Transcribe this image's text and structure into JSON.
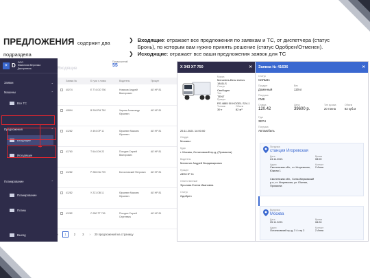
{
  "slide": {
    "title": "ПРЕДЛОЖЕНИЯ",
    "subtitle": "содержит два подраздела",
    "bullets": [
      {
        "lead": "Входящие",
        "text": ": отражает все предложения по заявкам и ТС, от диспетчера (статус Бронь), по которым вам нужно принять решение (статус Одобрен/Отменен)."
      },
      {
        "lead": "Исходящие",
        "text": ": отражает все ваши предложения заявок для ТС"
      }
    ]
  },
  "app": {
    "org_line1": "ООО",
    "org_line2": "Мамонова Вероника Дмитриевна",
    "sidebar": {
      "sections": [
        {
          "label": "Заявки"
        },
        {
          "label": "Машины"
        },
        {
          "label": "Предложения"
        },
        {
          "label": "Планирование"
        }
      ],
      "items": [
        {
          "label": "Все ТС"
        },
        {
          "label": "Входящие"
        },
        {
          "label": "Исходящие"
        },
        {
          "label": "Планирование"
        },
        {
          "label": "Планы"
        },
        {
          "label": "Выход"
        }
      ]
    },
    "main": {
      "ghost_title": "Входящие",
      "count_label": "Предложений",
      "count": "55",
      "columns": [
        "Заявка №",
        "Б гузи х ловок",
        "Водитель",
        "Прицеп"
      ],
      "rows": [
        {
          "id": "40274",
          "plate": "Е 774 ОО 750",
          "driver": "Новиков Андрей Викторович",
          "trailer": "АЕ НР 81"
        },
        {
          "id": "40894",
          "plate": "В 296 РМ 750",
          "driver": "Черняк Александр Юрьевич",
          "trailer": "АЕ НР 81"
        },
        {
          "id": "41282",
          "plate": "Х 494 ОР 11",
          "driver": "Юрьевин Максим Юрьевич",
          "trailer": "АЕ НР 81"
        },
        {
          "id": "41760",
          "plate": "Т 644 ОН 22",
          "driver": "Погодин Сергей Викторович",
          "trailer": "АЕ НР 81"
        },
        {
          "id": "41282",
          "plate": "Р 286 ОА 799",
          "driver": "Богословский Петрович",
          "trailer": "АЕ НР 81"
        },
        {
          "id": "41282",
          "plate": "У 221 ОВ 11",
          "driver": "Юрьевин Максим Юрьевич",
          "trailer": "АЕ НР 81"
        },
        {
          "id": "41282",
          "plate": "О 280 ТТ 799",
          "driver": "Погодин Сергей Сергеевич",
          "trailer": "АЕ НР 81"
        }
      ],
      "pager": [
        "1",
        "2",
        "3"
      ],
      "per_page": "20 предложений на страницу"
    }
  },
  "vehicle": {
    "plate": "Х 343 ХТ 750",
    "model_label": "Марка",
    "model": "Mercedes-Benz Actros 1841LS",
    "status_label": "Статус",
    "status": "Свободен",
    "type_label": "Тип",
    "type": "TENT",
    "trailer_label": "Прицеп",
    "trailer": "RS 4885 50 KOGEL S24-1",
    "load_label": "Тоннаж",
    "load": "39 т",
    "vol_label": "Объем",
    "vol": "82 м³",
    "date": "25.11.2021 14:00:00",
    "from_label": "Откуда",
    "from": "Москва г",
    "to_label": "Куда",
    "to": "г. Москва, Остаповский пр-д, (Промзона)",
    "driver_label": "Водитель",
    "driver": "Малютин Андрей Владимирович",
    "trailer2_label": "Прицеп",
    "trailer2": "АЕВ НР 11",
    "resp_label": "Ответственный",
    "resp": "Фролова Елена Ивановна",
    "status2_label": "Статус",
    "status2": "Одобрен"
  },
  "request": {
    "title": "Заявка № 41636",
    "status_label": "Статус",
    "status": "СИЛЬВА",
    "fields": [
      {
        "label": "Продукт",
        "value": "Доменный"
      },
      {
        "label": "Вес",
        "value": "120 кг"
      },
      {
        "label": "Погрузка",
        "value": "СМВ"
      },
      {
        "label": "Ставка",
        "value": "120.42"
      },
      {
        "label": "Цена",
        "value": "39600 р."
      },
      {
        "label": "Тип кузова",
        "value": "20 тонна"
      },
      {
        "label": "Объем",
        "value": "82 куб.м"
      }
    ],
    "cargo_label": "Груз",
    "cargo": "ЗЕРН",
    "loading_label": "Погрузка",
    "loading_type": "Автомобиль",
    "stops": [
      {
        "kind": "Погрузка",
        "place": "станция Игоревская",
        "date_label": "Дата",
        "date": "24.11.2021",
        "time_label": "Время",
        "time": "08:00",
        "addr_label": "Адрес",
        "addr": "Смоленская обл., ст. Игоревская, Южная 1",
        "contact_label": "Контакт",
        "contact": "2 Анна",
        "addr2": "Смоленская обл., Холм-Жирковский р-н, ст. Игоревская, ул. Южная, Промзона"
      },
      {
        "kind": "Выгрузка",
        "place": "Москва",
        "date_label": "Дата",
        "date": "25.11.2021",
        "time_label": "Время",
        "time": "08:00",
        "addr_label": "Адрес",
        "addr": "Останковский пр-д, 3 4 стр 2",
        "contact_label": "Контакт",
        "contact": "2 Анна"
      }
    ]
  },
  "colors": {
    "sidebar": "#2e2c4a",
    "accent": "#3a68d0",
    "highlight": "#e0262e"
  }
}
